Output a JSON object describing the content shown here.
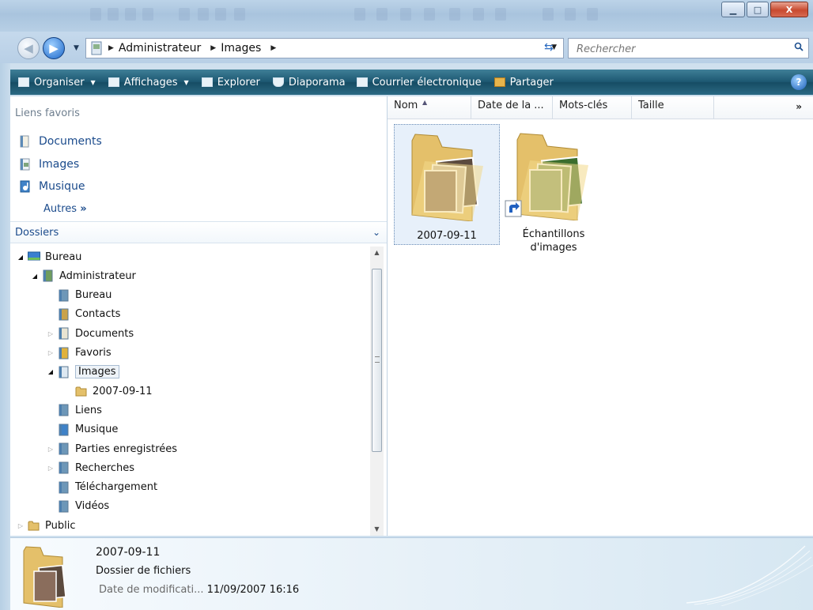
{
  "window": {
    "controls": {
      "minimize": "▁",
      "maximize": "□",
      "close": "X"
    }
  },
  "address": {
    "crumbs": [
      "Administrateur",
      "Images"
    ],
    "search_placeholder": "Rechercher"
  },
  "toolbar": {
    "organiser": "Organiser",
    "affichages": "Affichages",
    "explorer": "Explorer",
    "diaporama": "Diaporama",
    "courrier": "Courrier électronique",
    "partager": "Partager",
    "help": "?"
  },
  "nav": {
    "favorites_header": "Liens favoris",
    "favorites": [
      {
        "label": "Documents",
        "icon": "documents-icon"
      },
      {
        "label": "Images",
        "icon": "images-icon"
      },
      {
        "label": "Musique",
        "icon": "music-icon"
      }
    ],
    "more_label": "Autres",
    "more_chevron": "»",
    "folders_header": "Dossiers",
    "folders_chevron": "⌄"
  },
  "tree": [
    {
      "label": "Bureau",
      "level": 0,
      "expander": "open",
      "icon": "desktop-icon"
    },
    {
      "label": "Administrateur",
      "level": 1,
      "expander": "open",
      "icon": "user-folder-icon"
    },
    {
      "label": "Bureau",
      "level": 2,
      "expander": "none",
      "icon": "desktop-folder-icon"
    },
    {
      "label": "Contacts",
      "level": 2,
      "expander": "none",
      "icon": "contacts-icon"
    },
    {
      "label": "Documents",
      "level": 2,
      "expander": "closed",
      "icon": "documents-icon"
    },
    {
      "label": "Favoris",
      "level": 2,
      "expander": "closed",
      "icon": "favorites-icon"
    },
    {
      "label": "Images",
      "level": 2,
      "expander": "open",
      "icon": "images-icon",
      "selected": true
    },
    {
      "label": "2007-09-11",
      "level": 3,
      "expander": "none",
      "icon": "folder-icon"
    },
    {
      "label": "Liens",
      "level": 2,
      "expander": "none",
      "icon": "links-icon"
    },
    {
      "label": "Musique",
      "level": 2,
      "expander": "none",
      "icon": "music-icon"
    },
    {
      "label": "Parties enregistrées",
      "level": 2,
      "expander": "closed",
      "icon": "saved-games-icon"
    },
    {
      "label": "Recherches",
      "level": 2,
      "expander": "closed",
      "icon": "searches-icon"
    },
    {
      "label": "Téléchargement",
      "level": 2,
      "expander": "none",
      "icon": "downloads-icon"
    },
    {
      "label": "Vidéos",
      "level": 2,
      "expander": "none",
      "icon": "videos-icon"
    },
    {
      "label": "Public",
      "level": 0,
      "expander": "closed",
      "icon": "folder-icon"
    }
  ],
  "columns": [
    "Nom",
    "Date de la ...",
    "Mots-clés",
    "Taille"
  ],
  "columns_more": "»",
  "files": [
    {
      "name": "2007-09-11",
      "shortcut": false,
      "selected": true
    },
    {
      "name": "Échantillons d'images",
      "shortcut": true,
      "selected": false
    }
  ],
  "details": {
    "name": "2007-09-11",
    "type": "Dossier de fichiers",
    "date_label": "Date de modificati...",
    "date_value": "11/09/2007 16:16"
  },
  "colors": {
    "accent": "#1b4b8c",
    "toolbar": "#1d5872"
  }
}
